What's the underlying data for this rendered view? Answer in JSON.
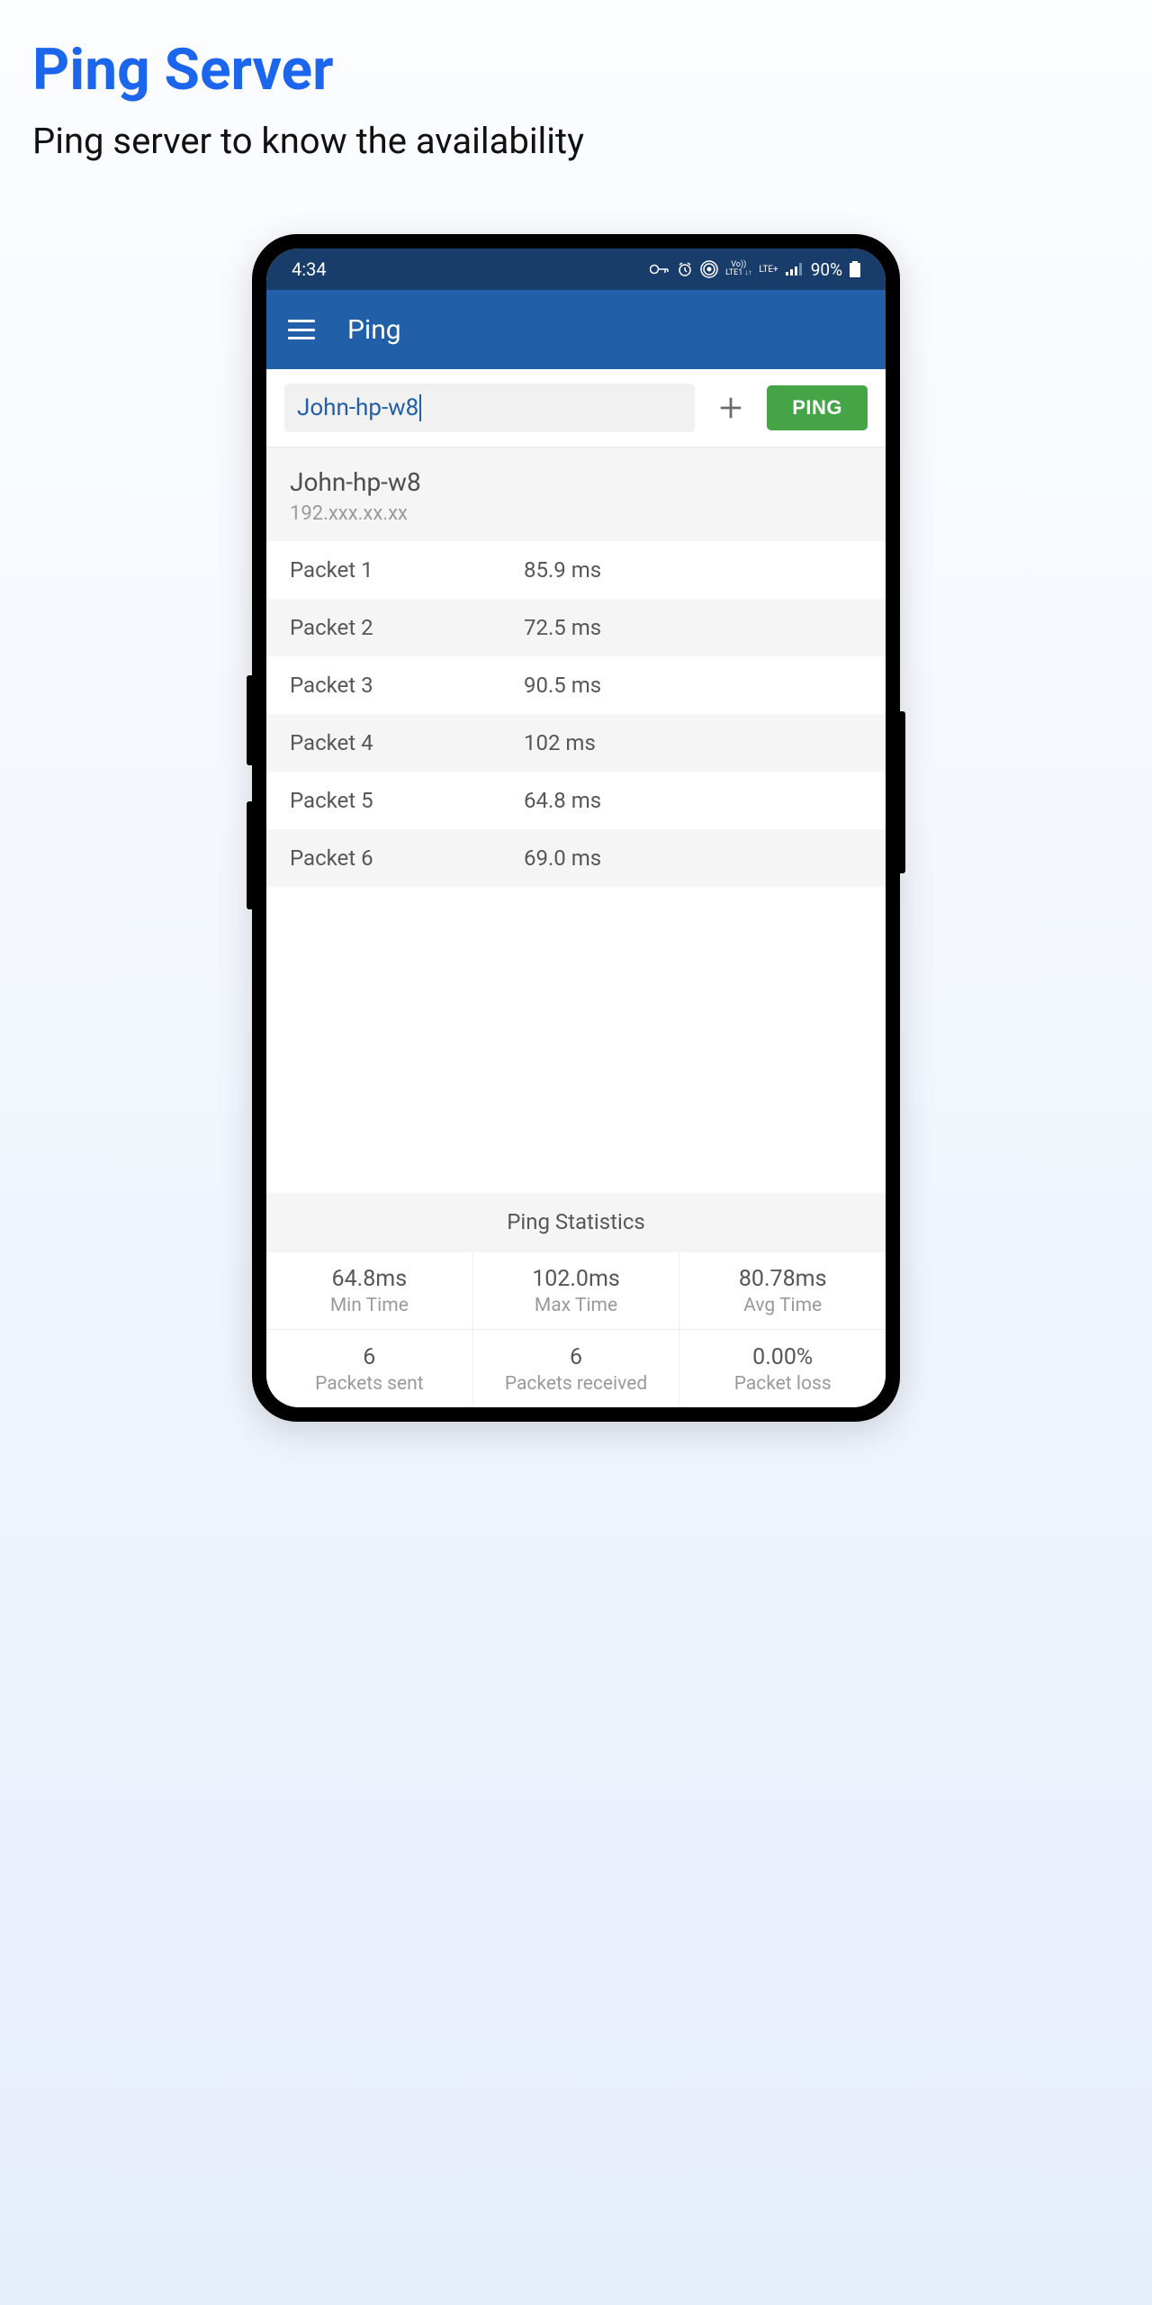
{
  "header": {
    "title": "Ping Server",
    "subtitle": "Ping server to know the availability"
  },
  "statusBar": {
    "time": "4:34",
    "lteLabel": "LTE+",
    "volteLabel": "Vo))",
    "lte1Label": "LTE1",
    "battery": "90%"
  },
  "appBar": {
    "title": "Ping"
  },
  "input": {
    "value": "John-hp-w8",
    "pingButton": "PING"
  },
  "target": {
    "name": "John-hp-w8",
    "ip": "192.xxx.xx.xx"
  },
  "packets": [
    {
      "label": "Packet 1",
      "value": "85.9 ms"
    },
    {
      "label": "Packet 2",
      "value": "72.5 ms"
    },
    {
      "label": "Packet 3",
      "value": "90.5 ms"
    },
    {
      "label": "Packet 4",
      "value": "102 ms"
    },
    {
      "label": "Packet 5",
      "value": "64.8 ms"
    },
    {
      "label": "Packet 6",
      "value": "69.0 ms"
    }
  ],
  "stats": {
    "header": "Ping Statistics",
    "row1": [
      {
        "value": "64.8ms",
        "label": "Min Time"
      },
      {
        "value": "102.0ms",
        "label": "Max Time"
      },
      {
        "value": "80.78ms",
        "label": "Avg Time"
      }
    ],
    "row2": [
      {
        "value": "6",
        "label": "Packets sent"
      },
      {
        "value": "6",
        "label": "Packets received"
      },
      {
        "value": "0.00%",
        "label": "Packet loss"
      }
    ]
  }
}
